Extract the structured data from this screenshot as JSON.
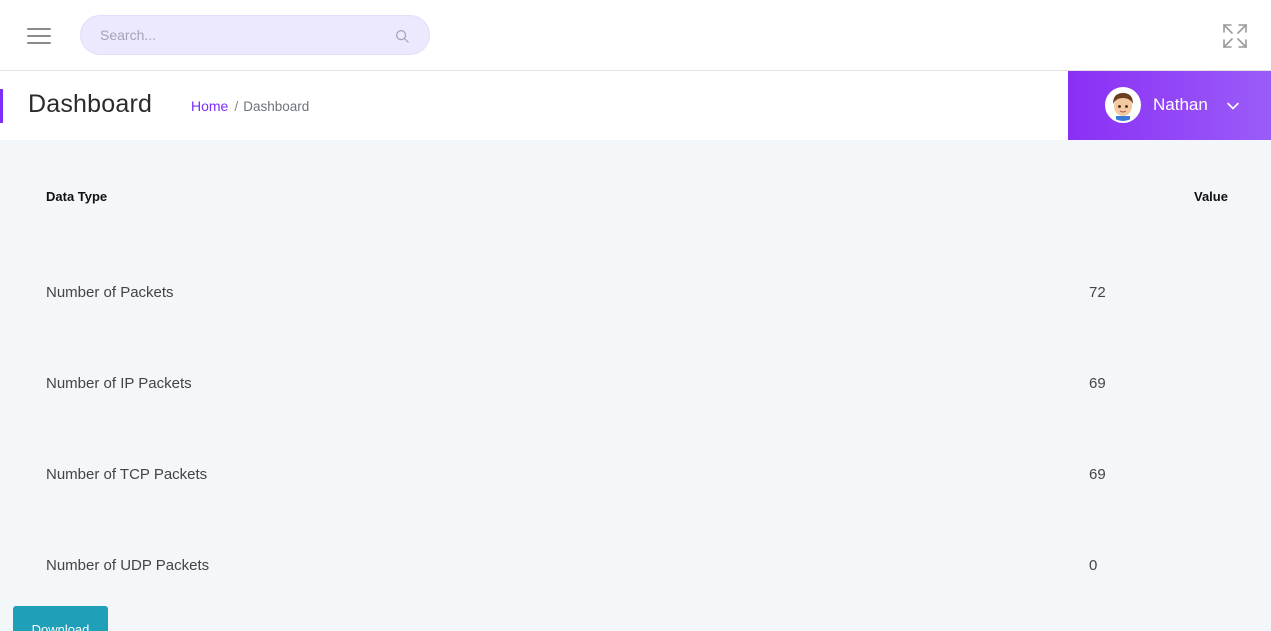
{
  "topbar": {
    "search_placeholder": "Search..."
  },
  "header": {
    "title": "Dashboard",
    "breadcrumb": {
      "home": "Home",
      "separator": "/",
      "current": "Dashboard"
    }
  },
  "user": {
    "name": "Nathan"
  },
  "table": {
    "headers": {
      "type": "Data Type",
      "value": "Value"
    },
    "rows": [
      {
        "label": "Number of Packets",
        "value": "72"
      },
      {
        "label": "Number of IP Packets",
        "value": "69"
      },
      {
        "label": "Number of TCP Packets",
        "value": "69"
      },
      {
        "label": "Number of UDP Packets",
        "value": "0"
      }
    ]
  },
  "actions": {
    "download_label": "Download"
  },
  "colors": {
    "accent": "#7b2ff7",
    "user_menu_bg": "#8a2ff5",
    "download_bg": "#1fa0b8",
    "content_bg": "#f3f7fa",
    "search_bg": "#ece8fd"
  }
}
